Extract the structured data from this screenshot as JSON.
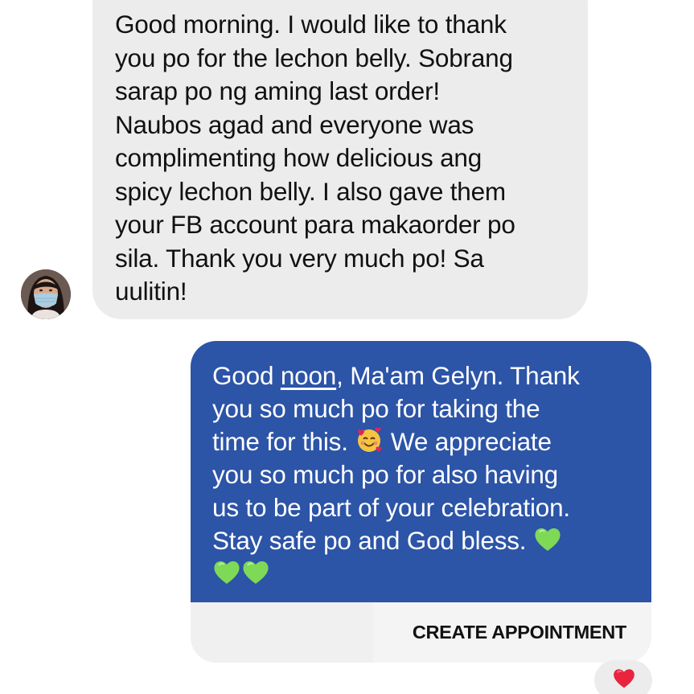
{
  "conversation": {
    "incoming_message": {
      "sender_avatar_icon": "woman-wearing-face-mask-avatar",
      "lines": [
        "Good morning. I would like to thank",
        "you po for the lechon belly. Sobrang",
        "sarap po ng aming last order!",
        "Naubos agad and everyone was",
        "complimenting how delicious ang",
        "spicy lechon belly. I also gave them",
        "your FB account para makaorder po",
        "sila. Thank you very much po! Sa",
        "uulitin!"
      ]
    },
    "outgoing_message": {
      "line1_before": "Good ",
      "line1_underlined": "noon",
      "line1_after": ", Ma'am Gelyn. Thank",
      "line2": "you so much po for taking the",
      "line3_before_emoji": "time for this.",
      "line3_after_emoji": " We appreciate",
      "line4": "you so much po for also having",
      "line5": "us to be part of your celebration.",
      "line6": "Stay safe po and God bless.",
      "emoji_smiling_hearts": "smiling-face-with-hearts-icon",
      "emoji_green_heart": "green-heart-icon",
      "background_color": "#2c54a7"
    },
    "action_button_label": "CREATE APPOINTMENT",
    "reaction": "red-heart-icon"
  }
}
